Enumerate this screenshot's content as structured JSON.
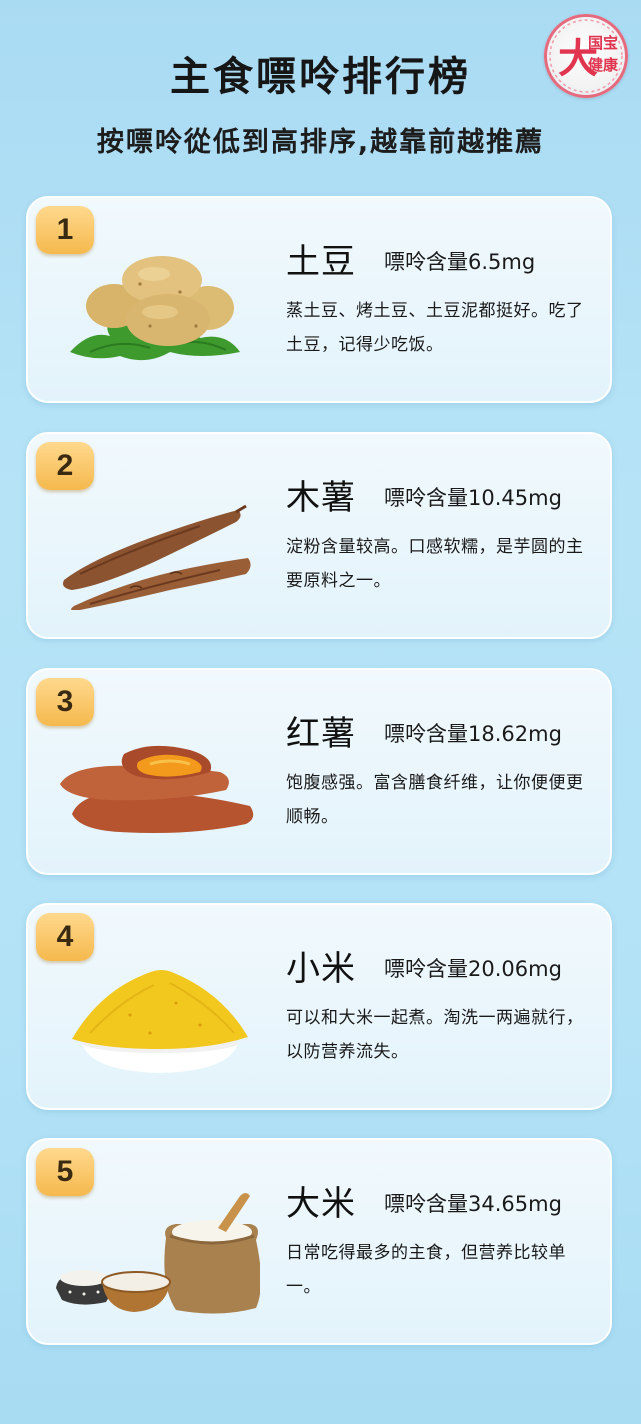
{
  "header": {
    "title": "主食嘌呤排行榜",
    "subtitle": "按嘌呤從低到高排序,越靠前越推薦",
    "logo_text_top": "国宝",
    "logo_text_big": "大",
    "logo_text_bottom": "健康"
  },
  "items": [
    {
      "rank": "1",
      "name": "土豆",
      "content": "嘌呤含量6.5mg",
      "desc": "蒸土豆、烤土豆、土豆泥都挺好。吃了土豆，记得少吃饭。",
      "icon": "potato-icon"
    },
    {
      "rank": "2",
      "name": "木薯",
      "content": "嘌呤含量10.45mg",
      "desc": "淀粉含量较高。口感软糯，是芋圆的主要原料之一。",
      "icon": "cassava-icon"
    },
    {
      "rank": "3",
      "name": "红薯",
      "content": "嘌呤含量18.62mg",
      "desc": "饱腹感强。富含膳食纤维，让你便便更顺畅。",
      "icon": "sweet-potato-icon"
    },
    {
      "rank": "4",
      "name": "小米",
      "content": "嘌呤含量20.06mg",
      "desc": "可以和大米一起煮。淘洗一两遍就行，以防营养流失。",
      "icon": "millet-icon"
    },
    {
      "rank": "5",
      "name": "大米",
      "content": "嘌呤含量34.65mg",
      "desc": "日常吃得最多的主食，但营养比较单一。",
      "icon": "rice-icon"
    }
  ],
  "colors": {
    "background": "#b3e2f6",
    "card": "#eaf6fc",
    "rank_badge": "#f5b94d",
    "logo_accent": "#e0344f"
  }
}
